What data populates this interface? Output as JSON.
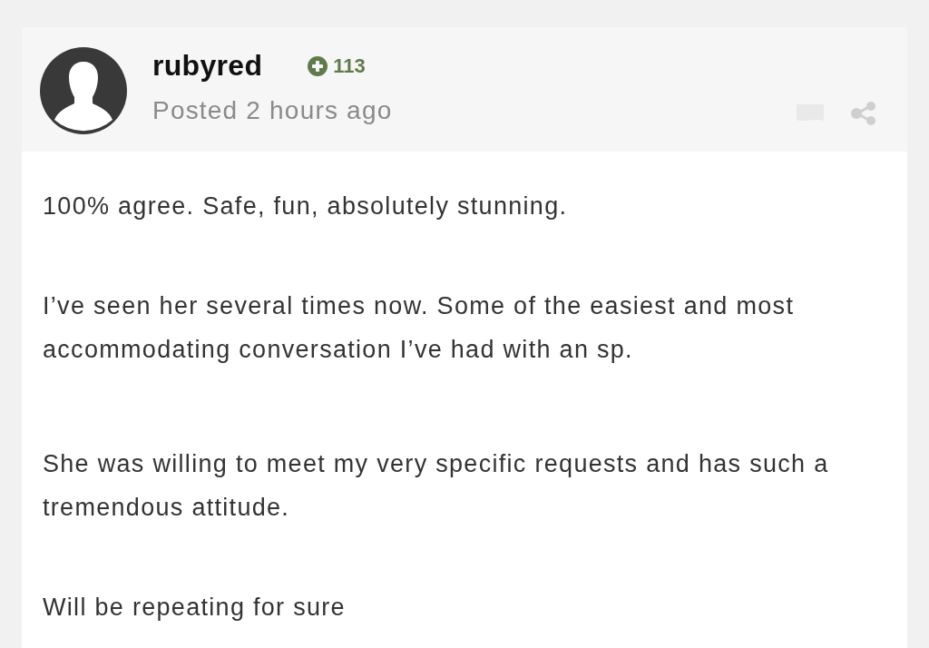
{
  "post": {
    "author": {
      "username": "rubyred",
      "reputation": "113",
      "posted": "Posted 2 hours ago"
    },
    "body": {
      "paragraphs": [
        "100% agree. Safe, fun, absolutely stunning.",
        "I’ve seen her several times now. Some of the easiest and most accommodating conversation I’ve had with an sp.",
        "She was willing to meet my very specific requests and has such a tremendous attitude.",
        "Will be repeating for sure"
      ]
    }
  }
}
